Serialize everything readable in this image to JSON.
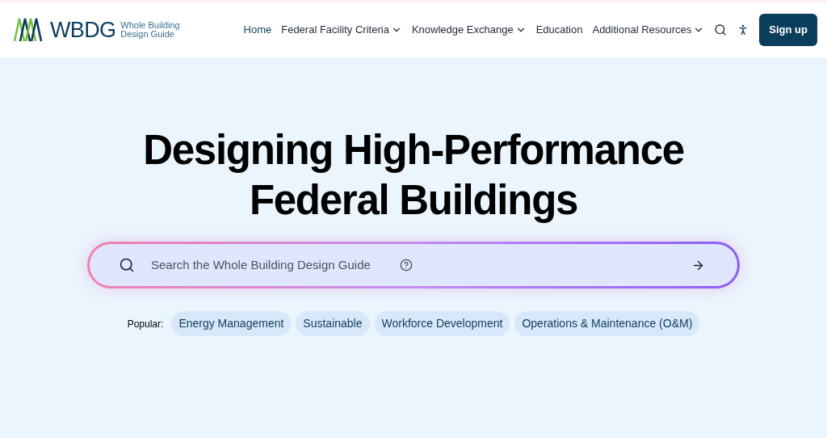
{
  "header": {
    "logo": {
      "mark": "WBDG",
      "tagline": "Whole Building Design Guide"
    },
    "nav": [
      {
        "label": "Home",
        "dropdown": false
      },
      {
        "label": "Federal Facility Criteria",
        "dropdown": true
      },
      {
        "label": "Knowledge Exchange",
        "dropdown": true
      },
      {
        "label": "Education",
        "dropdown": false
      },
      {
        "label": "Additional Resources",
        "dropdown": true
      }
    ],
    "signup": "Sign up"
  },
  "hero": {
    "title_lines": [
      "Designing High-Performance",
      "Federal Buildings"
    ],
    "search": {
      "placeholder": "Search the Whole Building Design Guide"
    },
    "popular_label": "Popular:",
    "popular": [
      "Energy Management",
      "Sustainable",
      "Workforce Development",
      "Operations & Maintenance (O&M)"
    ]
  }
}
